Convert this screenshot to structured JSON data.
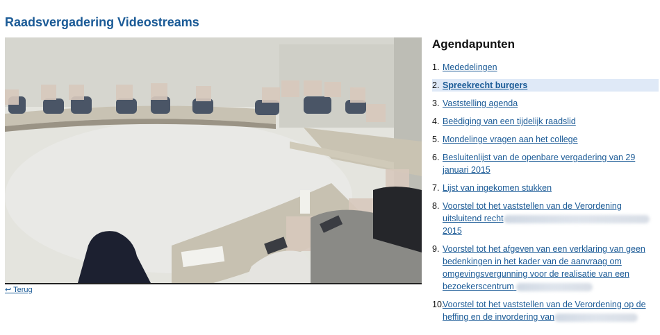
{
  "page": {
    "title": "Raadsvergadering Videostreams"
  },
  "video": {
    "description_icon": "video-player"
  },
  "back_link": {
    "label": "↩ Terug"
  },
  "agenda": {
    "title": "Agendapunten",
    "active_index": 1,
    "items": [
      {
        "num": "1.",
        "label": "Mededelingen"
      },
      {
        "num": "2.",
        "label": "Spreekrecht burgers"
      },
      {
        "num": "3.",
        "label": "Vaststelling agenda"
      },
      {
        "num": "4.",
        "label": "Beëdiging van een tijdelijk raadslid"
      },
      {
        "num": "5.",
        "label": "Mondelinge vragen aan het college"
      },
      {
        "num": "6.",
        "label": "Besluitenlijst van de openbare vergadering van 29 januari 2015"
      },
      {
        "num": "7.",
        "label": "Lijst van ingekomen stukken"
      },
      {
        "num": "8.",
        "label": "Voorstel tot het vaststellen van de Verordening uitsluitend recht",
        "tail": "2015"
      },
      {
        "num": "9.",
        "label": "Voorstel tot het afgeven van een verklaring van geen bedenkingen in het kader van de aanvraag om omgevingsvergunning voor de realisatie van een bezoekerscentrum"
      },
      {
        "num": "10.",
        "label": "Voorstel tot het vaststellen van de Verordening op de heffing en de invordering van"
      }
    ]
  },
  "colors": {
    "link": "#1a5a96",
    "active_bg": "#dfe9f7",
    "title": "#1a5a96"
  }
}
